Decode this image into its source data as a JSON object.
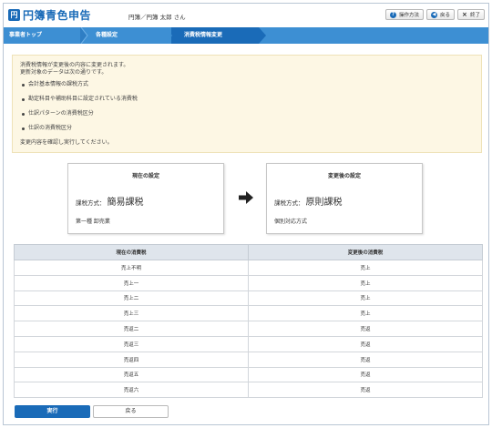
{
  "app": {
    "logo_mark": "円",
    "title": "円簿青色申告",
    "user": "円簿／円簿 太郎 さん"
  },
  "header_buttons": [
    {
      "label": "操作方法",
      "icon": "help-icon",
      "glyph": "?"
    },
    {
      "label": "戻る",
      "icon": "back-arrow-icon",
      "glyph": "◀"
    },
    {
      "label": "終了",
      "icon": "close-icon",
      "glyph": "×"
    }
  ],
  "breadcrumbs": [
    "事業者トップ",
    "各種設定",
    "消費税情報変更"
  ],
  "info": {
    "line1": "消費税情報が変更後の内容に変更されます。",
    "line2": "更新対象のデータは次の通りです。",
    "items": [
      "会計基本情報の課税方式",
      "勘定科目や補助科目に設定されている消費税",
      "仕訳パターンの消費税区分",
      "仕訳の消費税区分"
    ],
    "footer": "変更内容を確認し実行してください。"
  },
  "current": {
    "title": "現在の設定",
    "method_label": "課税方式：",
    "method_value": "簡易課税",
    "sub": "第一種 卸売業"
  },
  "after": {
    "title": "変更後の設定",
    "method_label": "課税方式：",
    "method_value": "原則課税",
    "sub": "個別対応方式"
  },
  "table": {
    "headers": [
      "現在の消費税",
      "変更後の消費税"
    ],
    "rows": [
      [
        "売上不明",
        "売上"
      ],
      [
        "売上一",
        "売上"
      ],
      [
        "売上二",
        "売上"
      ],
      [
        "売上三",
        "売上"
      ],
      [
        "売返二",
        "売返"
      ],
      [
        "売返三",
        "売返"
      ],
      [
        "売返四",
        "売返"
      ],
      [
        "売返五",
        "売返"
      ],
      [
        "売返六",
        "売返"
      ]
    ]
  },
  "actions": {
    "execute": "実行",
    "back": "戻る"
  },
  "colors": {
    "brand": "#1a6bb8",
    "crumb_bar": "#3d8fd3",
    "info_bg": "#fdf7e4"
  }
}
